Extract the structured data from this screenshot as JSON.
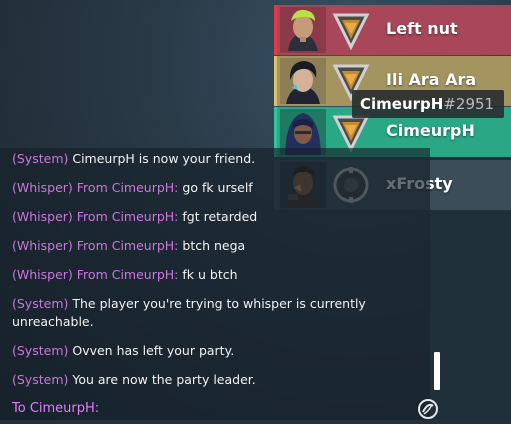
{
  "party": {
    "members": [
      {
        "name": "Left nut",
        "rank": "bronze-rank-icon",
        "card_color": "#a8465a",
        "accent_color": "#e03a48",
        "agent": "green-hair-agent-avatar"
      },
      {
        "name": "Ili Ara Ara",
        "rank": "bronze-rank-icon",
        "card_color": "#a49560",
        "accent_color": "#d8c468",
        "agent": "dark-hair-agent-avatar"
      },
      {
        "name": "CimeurpH",
        "rank": "bronze-rank-icon",
        "card_color": "#2aa886",
        "accent_color": "#31c79c",
        "agent": "hooded-agent-avatar"
      },
      {
        "name": "xFrosty",
        "rank": "unranked-icon",
        "card_color": "#3a4d59",
        "accent_color": "#3a4d59",
        "agent": "tattooed-agent-avatar"
      }
    ]
  },
  "tooltip": {
    "name": "CimeurpH",
    "tag": "#2951"
  },
  "chat": {
    "messages": [
      {
        "prefix": "(System)",
        "from": "",
        "text": "CimeurpH is now your friend."
      },
      {
        "prefix": "(Whisper)",
        "from": "From CimeurpH:",
        "text": "go fk urself"
      },
      {
        "prefix": "(Whisper)",
        "from": "From CimeurpH:",
        "text": "fgt retarded"
      },
      {
        "prefix": "(Whisper)",
        "from": "From CimeurpH:",
        "text": "btch nega"
      },
      {
        "prefix": "(Whisper)",
        "from": "From CimeurpH:",
        "text": "fk u btch"
      },
      {
        "prefix": "(System)",
        "from": "",
        "text": "The player you're trying to whisper is currently unreachable."
      },
      {
        "prefix": "(System)",
        "from": "",
        "text": "Ovven has left your party."
      },
      {
        "prefix": "(System)",
        "from": "",
        "text": "You are now the party leader."
      }
    ],
    "input_label": "To CimeurpH:"
  },
  "colors": {
    "whisper": "#cc77dd",
    "system": "#cc77dd",
    "input_label": "#e27dff"
  }
}
